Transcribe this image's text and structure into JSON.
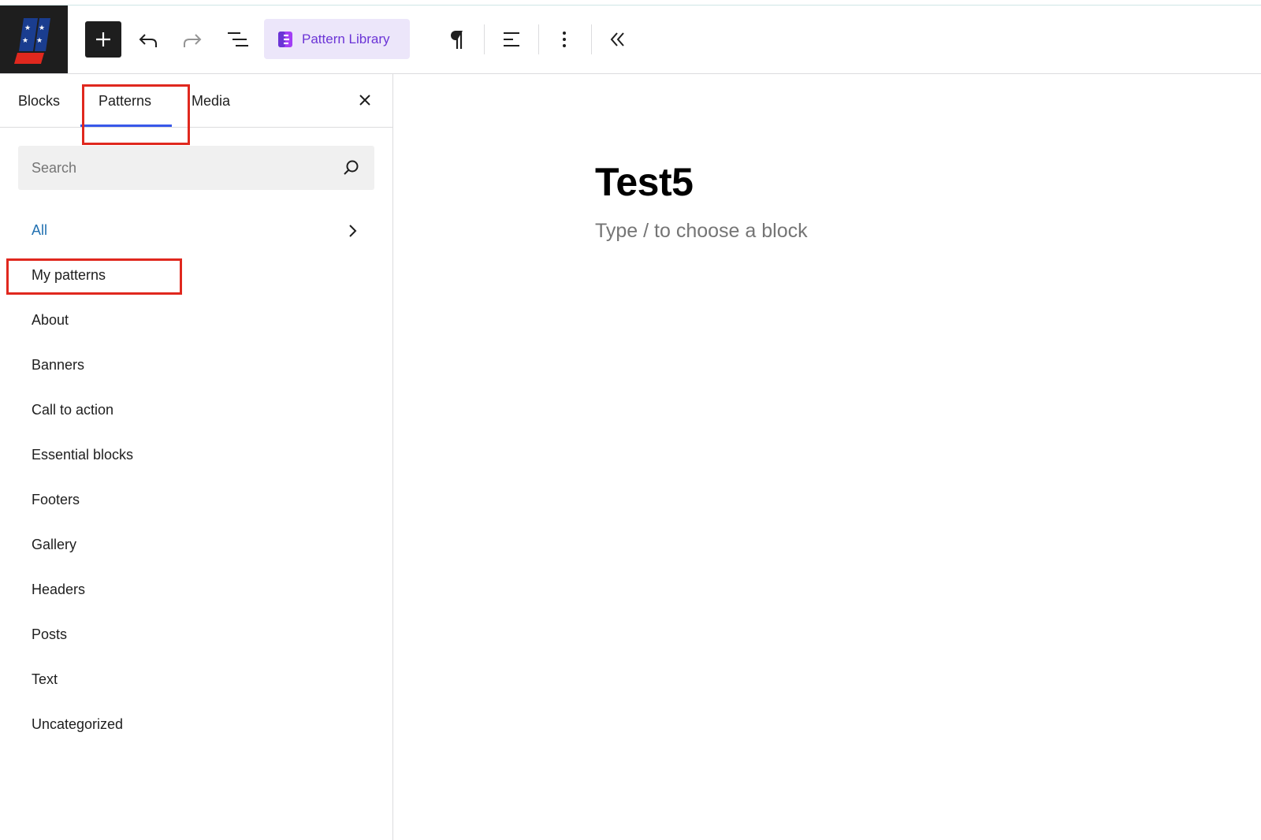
{
  "toolbar": {
    "add_block_label": "Add block",
    "undo_label": "Undo",
    "redo_label": "Redo",
    "document_overview_label": "Document overview",
    "pattern_library_label": "Pattern Library",
    "paragraph_label": "Paragraph",
    "align_label": "Align",
    "options_label": "Options",
    "collapse_label": "Collapse"
  },
  "inserter": {
    "tabs": [
      {
        "label": "Blocks"
      },
      {
        "label": "Patterns",
        "selected": true
      },
      {
        "label": "Media"
      }
    ],
    "search": {
      "placeholder": "Search",
      "value": ""
    },
    "categories": [
      {
        "label": "All",
        "active": true
      },
      {
        "label": "My patterns"
      },
      {
        "label": "About"
      },
      {
        "label": "Banners"
      },
      {
        "label": "Call to action"
      },
      {
        "label": "Essential blocks"
      },
      {
        "label": "Footers"
      },
      {
        "label": "Gallery"
      },
      {
        "label": "Headers"
      },
      {
        "label": "Posts"
      },
      {
        "label": "Text"
      },
      {
        "label": "Uncategorized"
      }
    ]
  },
  "editor": {
    "title": "Test5",
    "placeholder": "Type / to choose a block"
  },
  "colors": {
    "accent": "#2271b1",
    "tab_underline": "#3858e9",
    "pattern_library_bg": "#ece6fa",
    "pattern_library_text": "#6b34d6",
    "annotation_red": "#e0281e"
  }
}
